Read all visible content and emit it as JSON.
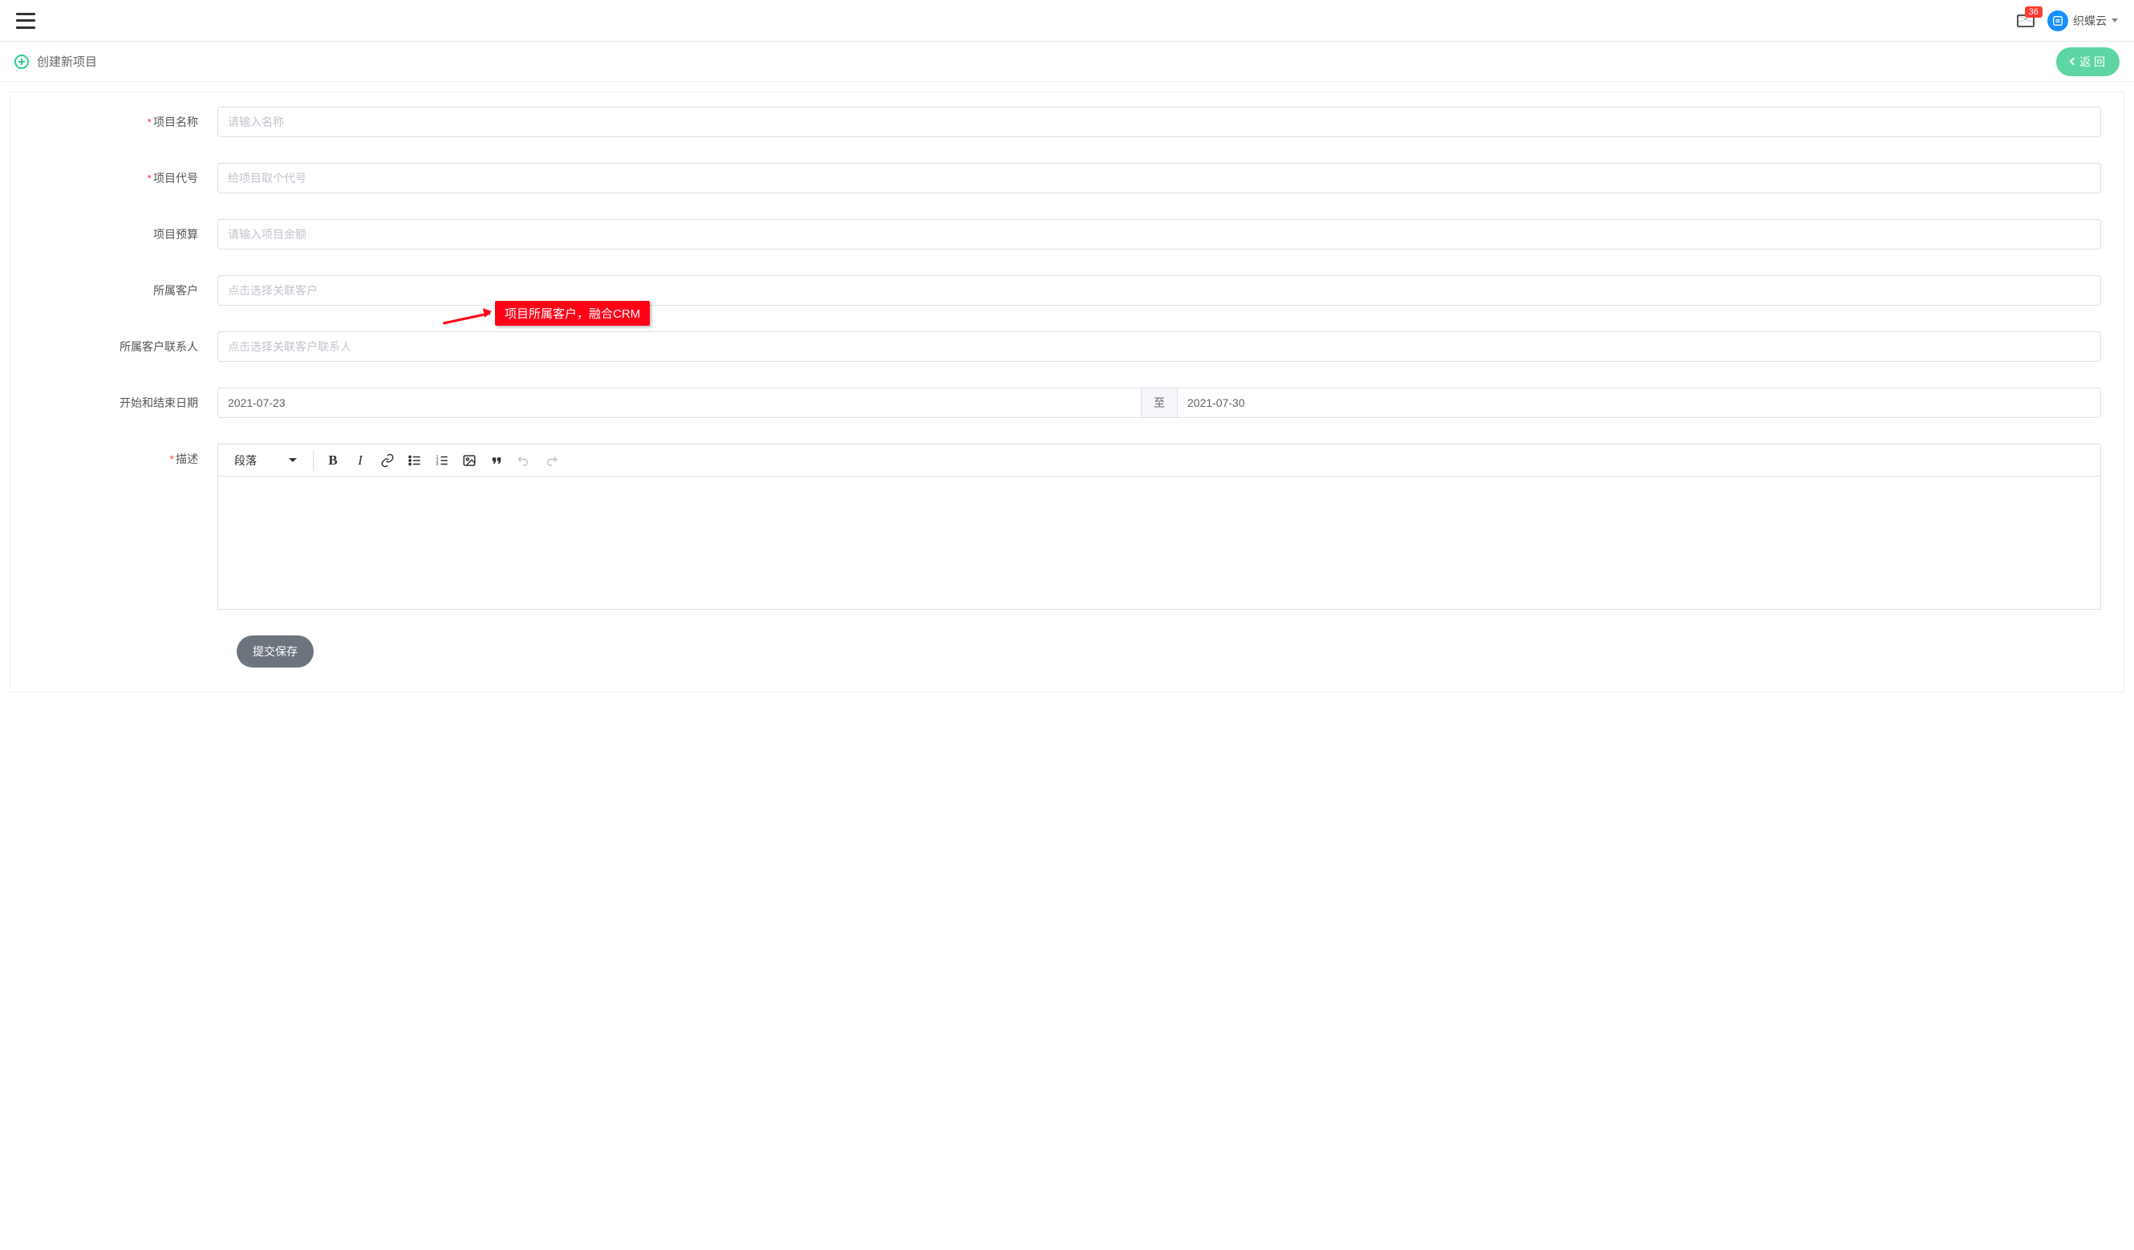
{
  "topbar": {
    "badge": "36",
    "username": "织蝶云"
  },
  "subbar": {
    "title": "创建新项目",
    "back": "返 回"
  },
  "form": {
    "project_name": {
      "label": "项目名称",
      "placeholder": "请输入名称",
      "value": ""
    },
    "project_code": {
      "label": "项目代号",
      "placeholder": "给项目取个代号",
      "value": ""
    },
    "budget": {
      "label": "项目预算",
      "placeholder": "请输入项目金额",
      "value": ""
    },
    "customer": {
      "label": "所属客户",
      "placeholder": "点击选择关联客户",
      "value": ""
    },
    "contact": {
      "label": "所属客户联系人",
      "placeholder": "点击选择关联客户联系人",
      "value": ""
    },
    "dates": {
      "label": "开始和结束日期",
      "start": "2021-07-23",
      "sep": "至",
      "end": "2021-07-30"
    },
    "desc": {
      "label": "描述"
    }
  },
  "editor": {
    "paragraph": "段落"
  },
  "callout": "项目所属客户，融合CRM",
  "buttons": {
    "submit": "提交保存"
  }
}
